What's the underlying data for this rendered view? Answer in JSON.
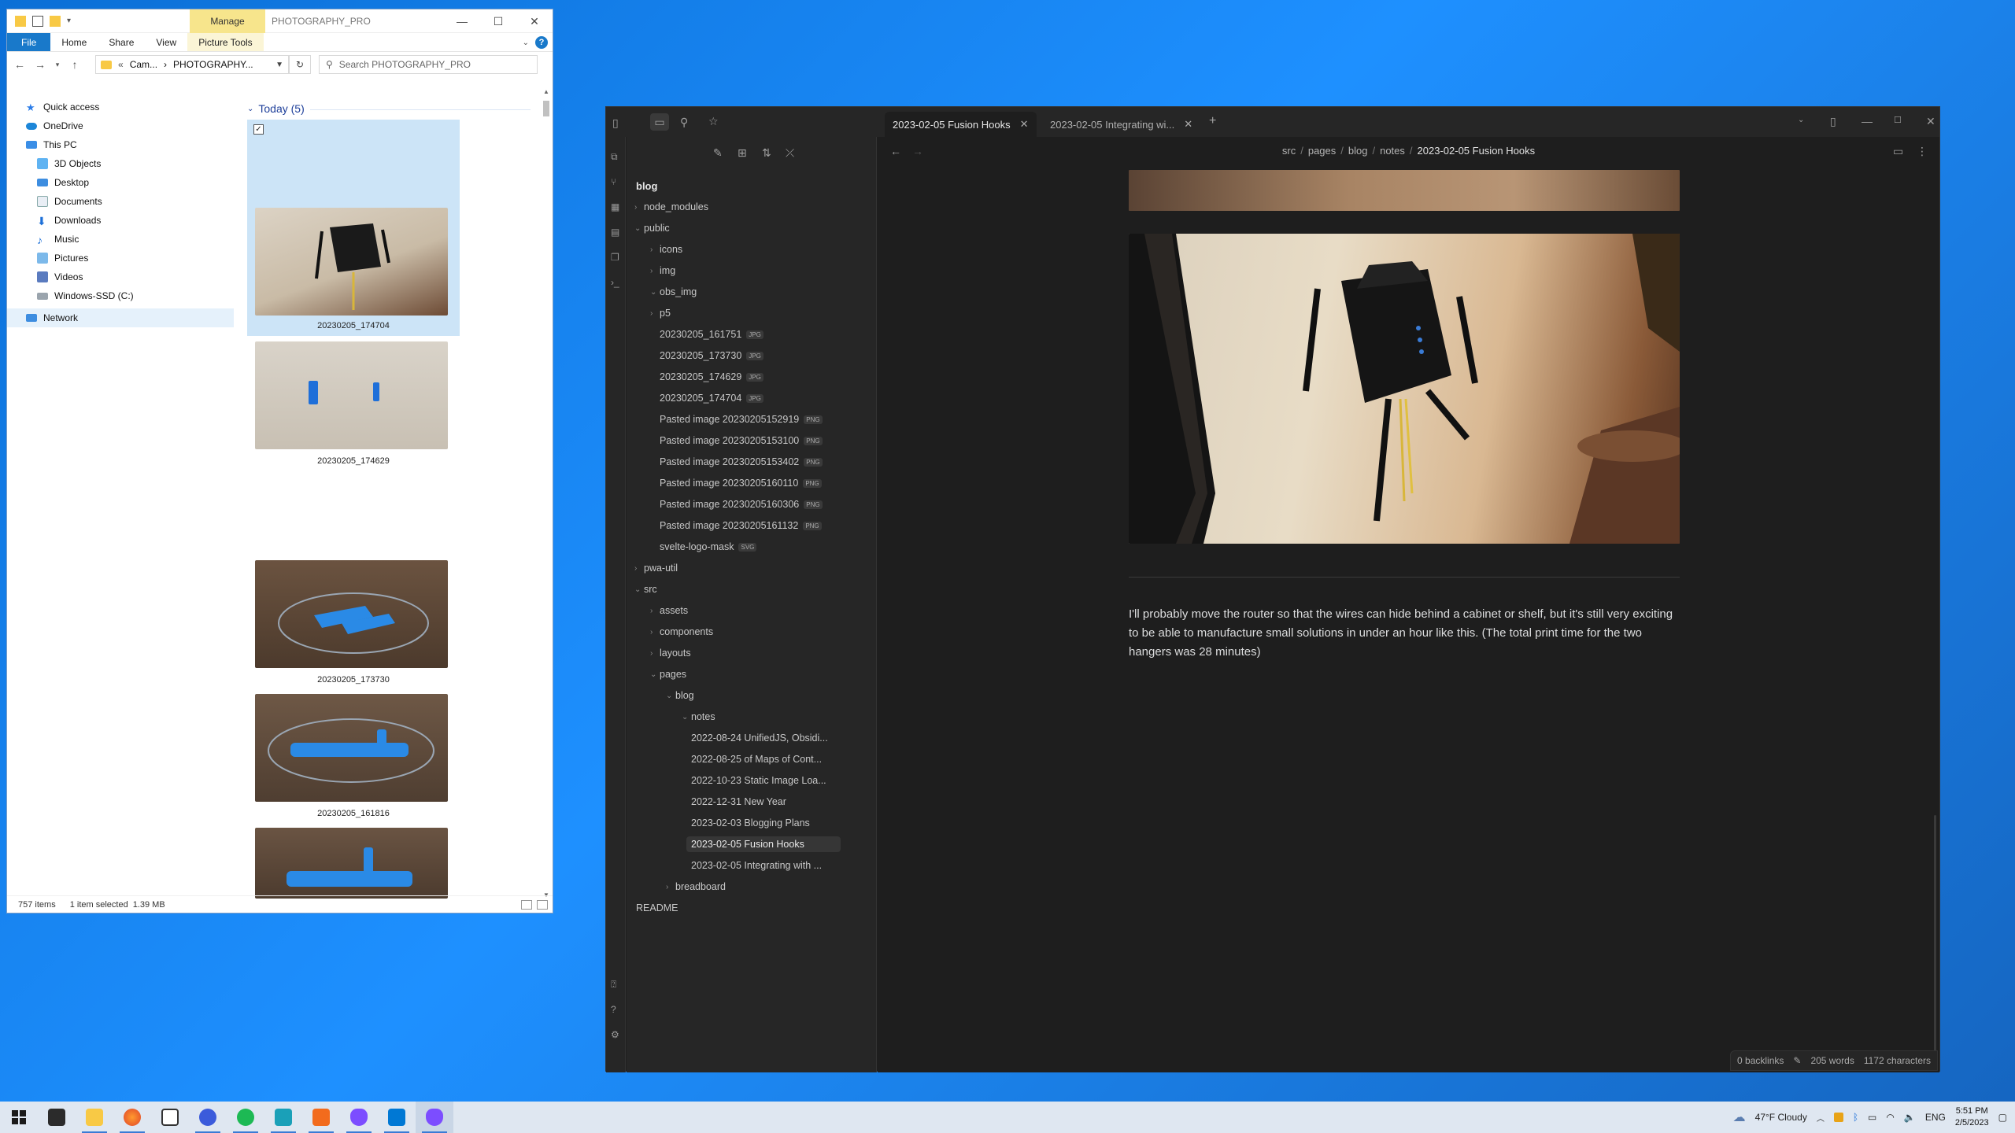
{
  "explorer": {
    "title": "PHOTOGRAPHY_PRO",
    "manage_label": "Manage",
    "ribbon_tabs": [
      "File",
      "Home",
      "Share",
      "View",
      "Picture Tools"
    ],
    "address": {
      "part1": "Cam...",
      "sep": "›",
      "part2": "PHOTOGRAPHY..."
    },
    "search_placeholder": "Search PHOTOGRAPHY_PRO",
    "nav": {
      "quick_access": "Quick access",
      "onedrive": "OneDrive",
      "this_pc": "This PC",
      "items": [
        "3D Objects",
        "Desktop",
        "Documents",
        "Downloads",
        "Music",
        "Pictures",
        "Videos",
        "Windows-SSD (C:)"
      ],
      "network": "Network"
    },
    "group_header": "Today (5)",
    "thumbnails": [
      {
        "caption": "20230205_174704"
      },
      {
        "caption": "20230205_174629"
      },
      {
        "caption": "20230205_173730"
      },
      {
        "caption": "20230205_161816"
      }
    ],
    "status": {
      "items": "757 items",
      "selected": "1 item selected",
      "size": "1.39 MB"
    }
  },
  "obsidian": {
    "tabs": [
      {
        "label": "2023-02-05 Fusion Hooks"
      },
      {
        "label": "2023-02-05 Integrating wi..."
      }
    ],
    "breadcrumbs": [
      "src",
      "pages",
      "blog",
      "notes",
      "2023-02-05 Fusion Hooks"
    ],
    "tree": {
      "root": "blog",
      "node_modules": "node_modules",
      "public": "public",
      "icons": "icons",
      "img": "img",
      "obs_img": "obs_img",
      "p5": "p5",
      "files": [
        {
          "name": "20230205_161751",
          "ext": "JPG"
        },
        {
          "name": "20230205_173730",
          "ext": "JPG"
        },
        {
          "name": "20230205_174629",
          "ext": "JPG"
        },
        {
          "name": "20230205_174704",
          "ext": "JPG"
        },
        {
          "name": "Pasted image 20230205152919",
          "ext": "PNG"
        },
        {
          "name": "Pasted image 20230205153100",
          "ext": "PNG"
        },
        {
          "name": "Pasted image 20230205153402",
          "ext": "PNG"
        },
        {
          "name": "Pasted image 20230205160110",
          "ext": "PNG"
        },
        {
          "name": "Pasted image 20230205160306",
          "ext": "PNG"
        },
        {
          "name": "Pasted image 20230205161132",
          "ext": "PNG"
        },
        {
          "name": "svelte-logo-mask",
          "ext": "SVG"
        }
      ],
      "pwa_util": "pwa-util",
      "src": "src",
      "assets": "assets",
      "components": "components",
      "layouts": "layouts",
      "pages": "pages",
      "blog": "blog",
      "notes": "notes",
      "notes_files": [
        "2022-08-24 UnifiedJS, Obsidi...",
        "2022-08-25 of Maps of Cont...",
        "2022-10-23 Static Image Loa...",
        "2022-12-31 New Year",
        "2023-02-03 Blogging Plans",
        "2023-02-05 Fusion Hooks",
        "2023-02-05 Integrating with ..."
      ],
      "breadboard": "breadboard",
      "readme": "README"
    },
    "paragraph": "I'll probably move the router so that the wires can hide behind a cabinet or shelf, but it's still very exciting to be able to manufacture small solutions in under an hour like this. (The total print time for the two hangers was 28 minutes)",
    "status": {
      "backlinks": "0 backlinks",
      "words": "205 words",
      "characters": "1172 characters"
    }
  },
  "taskbar": {
    "weather": "47°F  Cloudy",
    "language": "ENG",
    "time": "5:51 PM",
    "date": "2/5/2023"
  },
  "colors": {
    "desktop": "#1e90ff",
    "obsidian_bg": "#1e1e1e",
    "obsidian_panel": "#262626",
    "explorer_accent": "#1979ca",
    "manage_tab": "#f7e58c"
  }
}
